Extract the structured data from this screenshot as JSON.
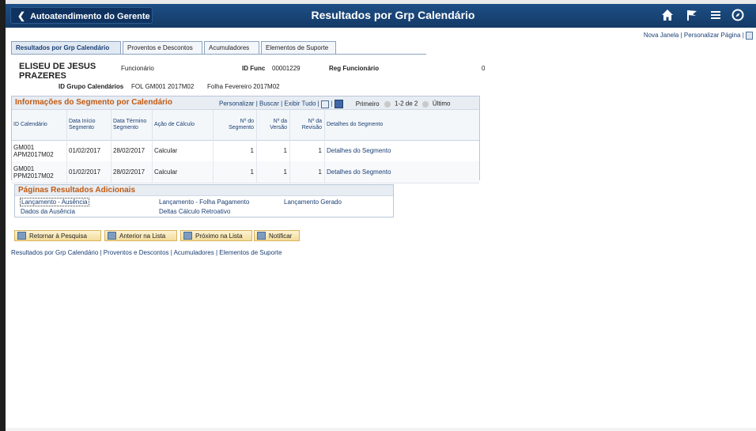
{
  "header": {
    "back_label": "Autoatendimento do Gerente",
    "title": "Resultados por Grp Calendário"
  },
  "top_links": {
    "new_window": "Nova Janela",
    "sep": " | ",
    "personalize": "Personalizar Página",
    "trail": " | "
  },
  "tabs": [
    {
      "label": "Resultados por Grp Calendário"
    },
    {
      "label": "Proventos e Descontos"
    },
    {
      "label": "Acumuladores"
    },
    {
      "label": "Elementos de Suporte"
    }
  ],
  "employee": {
    "name": "ELISEU DE JESUS PRAZERES",
    "role": "Funcionário",
    "id_func_label": "ID Func",
    "id_func_value": "00001229",
    "reg_label": "Reg Funcionário",
    "reg_value": "0",
    "group_label": "ID Grupo Calendários",
    "group_value": "FOL GM001 2017M02",
    "group_desc": "Folha Fevereiro 2017M02"
  },
  "segment": {
    "title": "Informações do Segmento por Calendário",
    "tools": "Personalizar | Buscar | Exibir Tudo |",
    "nav_first": "Primeiro",
    "nav_range": "1-2 de 2",
    "nav_last": "Último",
    "columns": [
      "ID Calendário",
      "Data Início Segmento",
      "Data Término Segmento",
      "Ação de Cálculo",
      "Nº do Segmento",
      "Nº da Versão",
      "Nº da Revisão",
      "Detalhes do Segmento"
    ],
    "rows": [
      {
        "id": "GM001 APM2017M02",
        "start": "01/02/2017",
        "end": "28/02/2017",
        "action": "Calcular",
        "seg": "1",
        "ver": "1",
        "rev": "1",
        "details": "Detalhes do Segmento"
      },
      {
        "id": "GM001 PPM2017M02",
        "start": "01/02/2017",
        "end": "28/02/2017",
        "action": "Calcular",
        "seg": "1",
        "ver": "1",
        "rev": "1",
        "details": "Detalhes do Segmento"
      }
    ]
  },
  "additional": {
    "title": "Páginas Resultados Adicionais",
    "links": [
      "Lançamento - Ausência",
      "Lançamento - Folha Pagamento",
      "Lançamento Gerado",
      "Dados da Ausência",
      "Deltas Cálculo Retroativo"
    ]
  },
  "buttons": {
    "return": "Retornar à Pesquisa",
    "prev": "Anterior na Lista",
    "next": "Próximo na Lista",
    "notify": "Notificar"
  },
  "bottom_links": "Resultados por Grp Calendário | Proventos e Descontos | Acumuladores | Elementos de Suporte",
  "colors": {
    "header_bg": "#1d4f86",
    "section_title": "#c05a12",
    "link": "#1a3f73",
    "button_bg": "#f4dc9a"
  },
  "icons": [
    "chevron-left-icon",
    "home-icon",
    "flag-icon",
    "menu-icon",
    "compass-icon",
    "grid-icon",
    "excel-icon",
    "arrow-left-icon",
    "arrow-right-icon"
  ]
}
